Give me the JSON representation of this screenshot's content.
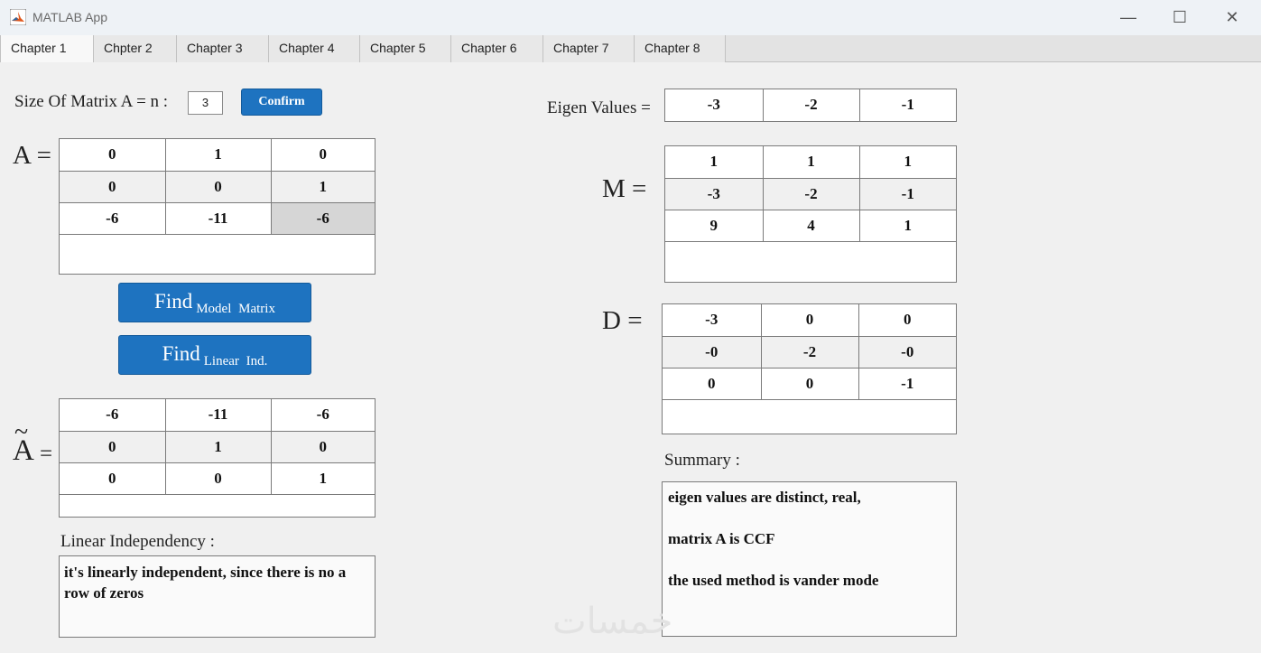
{
  "window": {
    "title": "MATLAB App",
    "controls": [
      "—",
      "☐",
      "✕"
    ]
  },
  "tabs": [
    {
      "label": "Chapter 1",
      "active": true
    },
    {
      "label": "Chpter 2",
      "active": false
    },
    {
      "label": "Chapter 3",
      "active": false
    },
    {
      "label": "Chapter 4",
      "active": false
    },
    {
      "label": "Chapter 5",
      "active": false
    },
    {
      "label": "Chapter 6",
      "active": false
    },
    {
      "label": "Chapter 7",
      "active": false
    },
    {
      "label": "Chapter 8",
      "active": false
    }
  ],
  "size_input": {
    "label": "Size Of Matrix A = n :",
    "value": "3",
    "confirm_label": "Confirm"
  },
  "matrix_a": {
    "label": "A =",
    "rows": [
      [
        "0",
        "1",
        "0"
      ],
      [
        "0",
        "0",
        "1"
      ],
      [
        "-6",
        "-11",
        "-6"
      ]
    ]
  },
  "buttons": {
    "find_model": {
      "main": "Find",
      "sub": "Model Matrix"
    },
    "find_linear": {
      "main": "Find",
      "sub": "Linear Ind."
    }
  },
  "matrix_a_tilde": {
    "label_symbol": "A",
    "label_tilde": "~",
    "label_eq": "=",
    "rows": [
      [
        "-6",
        "-11",
        "-6"
      ],
      [
        "0",
        "1",
        "0"
      ],
      [
        "0",
        "0",
        "1"
      ]
    ]
  },
  "linear_independency": {
    "label": "Linear Independency :",
    "text": "it's linearly independent, since there is no a row of zeros"
  },
  "eigen_values": {
    "label": "Eigen Values =",
    "values": [
      "-3",
      "-2",
      "-1"
    ]
  },
  "matrix_m": {
    "label": "M =",
    "rows": [
      [
        "1",
        "1",
        "1"
      ],
      [
        "-3",
        "-2",
        "-1"
      ],
      [
        "9",
        "4",
        "1"
      ]
    ]
  },
  "matrix_d": {
    "label": "D =",
    "rows": [
      [
        "-3",
        "0",
        "0"
      ],
      [
        "-0",
        "-2",
        "-0"
      ],
      [
        "0",
        "0",
        "-1"
      ]
    ]
  },
  "summary": {
    "label": "Summary :",
    "lines": [
      "eigen values are distinct, real,",
      "matrix A is CCF",
      "the used method is vander mode"
    ]
  },
  "watermark": "خمسات",
  "colors": {
    "button_blue": "#1e73c0",
    "background": "#f0f0f0",
    "selected_cell": "#d6d6d6"
  }
}
